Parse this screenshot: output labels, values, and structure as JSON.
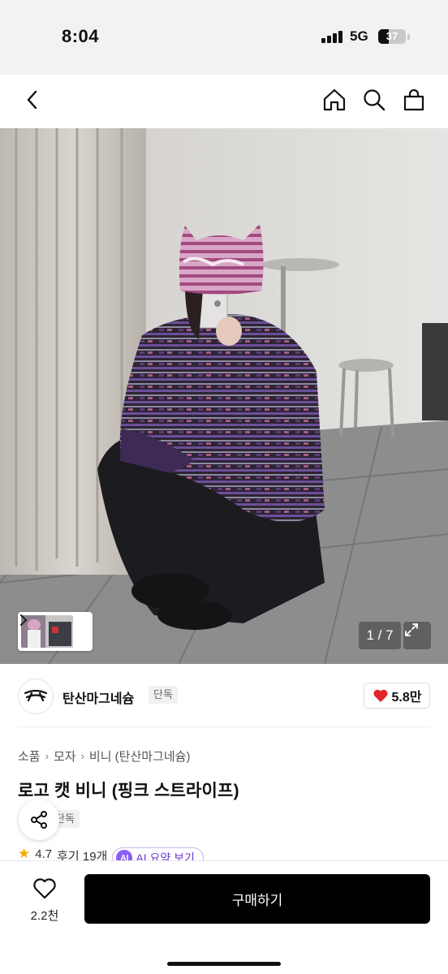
{
  "status_bar": {
    "time": "8:04",
    "network": "5G",
    "battery_level": 37,
    "battery_text": "37"
  },
  "nav": {
    "back_icon": "chevron-left-icon",
    "home_icon": "home-icon",
    "search_icon": "search-icon",
    "cart_icon": "shopping-bag-icon"
  },
  "gallery": {
    "counter": "1 / 7",
    "expand_icon": "expand-icon"
  },
  "brand": {
    "name": "탄산마그네슘",
    "tag": "단독",
    "likes": "5.8만",
    "like_color": "#e0262b"
  },
  "product": {
    "breadcrumb": [
      "소품",
      "모자",
      "비니 (탄산마그네슘)"
    ],
    "title": "로고 캣 비니 (핑크 스트라이프)",
    "exclusive_tag": "단독",
    "rating": "4.7",
    "reviews": "후기 19개",
    "ai_badge": "AI",
    "ai_summary": "AI 요약 보기"
  },
  "bottom_bar": {
    "wish_count": "2.2천",
    "buy_label": "구매하기"
  },
  "colors": {
    "accent_ai": "#8b5cf6",
    "buy_button": "#000000"
  }
}
